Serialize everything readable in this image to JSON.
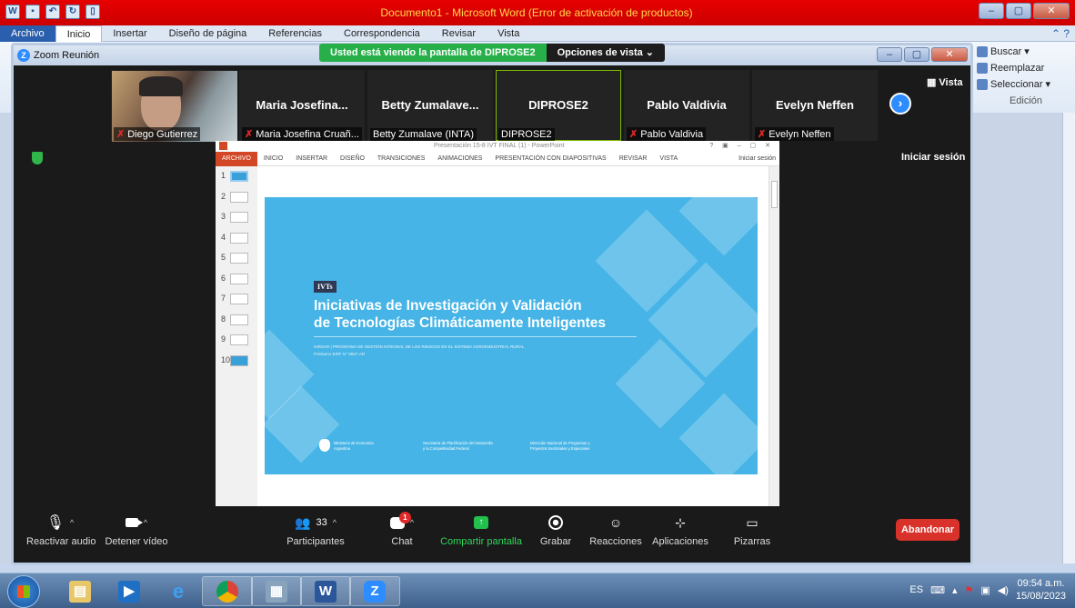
{
  "word": {
    "title": "Documento1  -  Microsoft Word (Error de activación de productos)",
    "tabs": [
      "Archivo",
      "Inicio",
      "Insertar",
      "Diseño de página",
      "Referencias",
      "Correspondencia",
      "Revisar",
      "Vista"
    ],
    "right_panel": {
      "buscar": "Buscar ▾",
      "reemplazar": "Reemplazar",
      "seleccionar": "Seleccionar ▾",
      "group": "Edición"
    }
  },
  "zoom": {
    "window_title": "Zoom Reunión",
    "share_banner": "Usted está viendo la pantalla de DIPROSE2",
    "view_options": "Opciones de vista  ⌄",
    "vista_label": "Vista",
    "iniciar_sesion": "Iniciar sesión",
    "participants": [
      {
        "center": "",
        "bottom": "Diego Gutierrez",
        "muted": true,
        "video": true
      },
      {
        "center": "Maria Josefina...",
        "bottom": "Maria Josefina Cruañ...",
        "muted": true
      },
      {
        "center": "Betty Zumalave...",
        "bottom": "Betty Zumalave (INTA)",
        "muted": false
      },
      {
        "center": "DIPROSE2",
        "bottom": "DIPROSE2",
        "muted": false,
        "active": true
      },
      {
        "center": "Pablo Valdivia",
        "bottom": "Pablo Valdivia",
        "muted": true
      },
      {
        "center": "Evelyn Neffen",
        "bottom": "Evelyn Neffen",
        "muted": true
      }
    ],
    "toolbar": {
      "audio": "Reactivar audio",
      "video": "Detener vídeo",
      "participants": "Participantes",
      "participants_count": "33",
      "chat": "Chat",
      "chat_badge": "1",
      "share": "Compartir pantalla",
      "record": "Grabar",
      "reactions": "Reacciones",
      "apps": "Aplicaciones",
      "whiteboard": "Pizarras",
      "leave": "Abandonar"
    }
  },
  "powerpoint": {
    "title": "Presentación 15-8 IVT FINAL (1) - PowerPoint",
    "window_controls": "? ▣ – ▢ ✕",
    "tabs": [
      "ARCHIVO",
      "INICIO",
      "INSERTAR",
      "DISEÑO",
      "TRANSICIONES",
      "ANIMACIONES",
      "PRESENTACIÓN CON DIAPOSITIVAS",
      "REVISAR",
      "VISTA"
    ],
    "login": "Iniciar sesión",
    "slide_numbers": [
      "1",
      "2",
      "3",
      "4",
      "5",
      "6",
      "7",
      "8",
      "9",
      "10"
    ],
    "slide": {
      "tag": "IVTs",
      "headline_line1": "Iniciativas de Investigación y Validación",
      "headline_line2": "de Tecnologías Climáticamente Inteligentes",
      "program": "GIRSAR  |  PROGRAMA DE GESTIÓN INTEGRAL DE LOS RIESGOS EN EL SISTEMA AGROINDUSTRIAL RURAL",
      "loan": "Préstamo BIRF N° 8867-AR",
      "footer_ministry": "Ministerio de Economía Argentina",
      "footer_secretaria": "Secretaría de Planificación del Desarrollo y la Competitividad Federal",
      "footer_direccion": "Dirección Nacional de Programas y Proyectos Sectoriales y Especiales"
    }
  },
  "taskbar": {
    "lang": "ES",
    "time": "09:54 a.m.",
    "date": "15/08/2023"
  }
}
